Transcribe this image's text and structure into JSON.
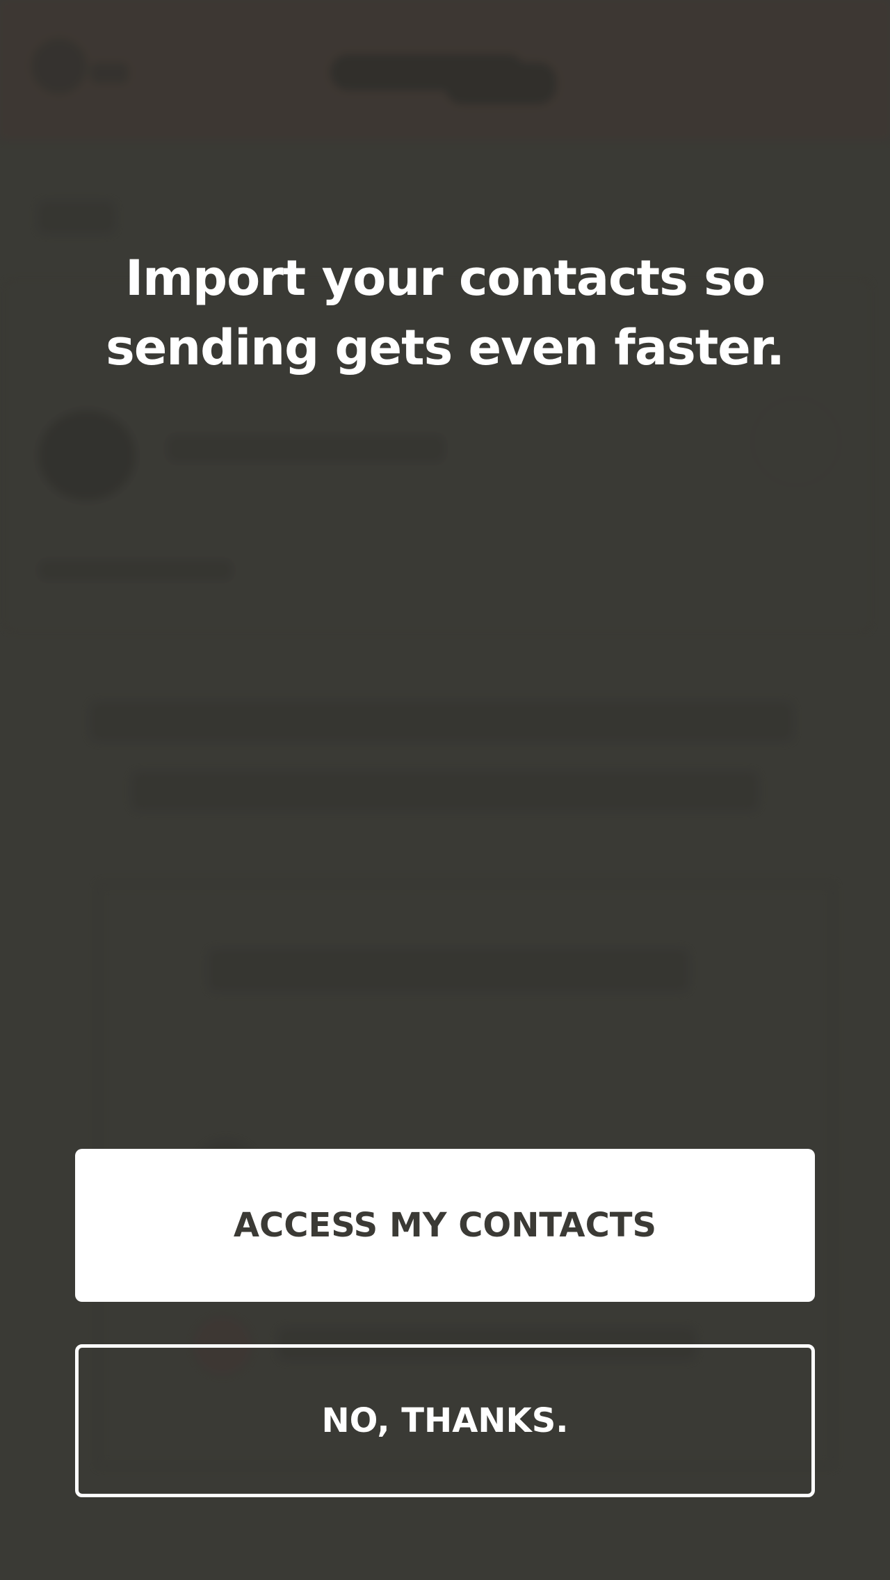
{
  "dialog": {
    "headline_line1": "Import your contacts so",
    "headline_line2": "sending gets even faster.",
    "primary_button_label": "ACCESS MY CONTACTS",
    "secondary_button_label": "NO, THANKS."
  },
  "colors": {
    "overlay": "#3c3c37",
    "background_header": "#4a3530",
    "button_primary_bg": "#ffffff",
    "button_primary_text": "#3b3a35",
    "button_secondary_border": "#ffffff",
    "headline_text": "#ffffff"
  }
}
